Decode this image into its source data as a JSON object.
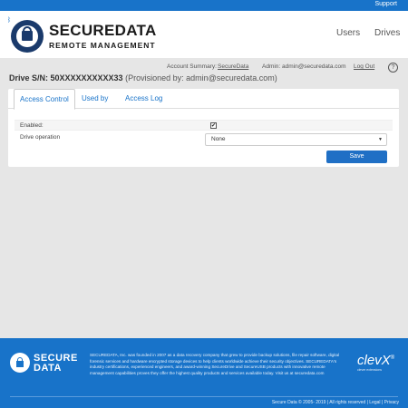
{
  "topbar": {
    "support": "Support"
  },
  "brand": {
    "line1": "SECUREDATA",
    "line2": "REMOTE MANAGEMENT",
    "mark": "®"
  },
  "nav": {
    "users": "Users",
    "drives": "Drives"
  },
  "account": {
    "summary_label": "Account Summary:",
    "summary_link": "SecureData",
    "admin_label": "Admin:",
    "admin_email": "admin@securedata.com",
    "logout": "Log Out",
    "help": "?"
  },
  "drive": {
    "title": "Drive S/N: 50XXXXXXXXXX33",
    "provisioned": "(Provisioned by: admin@securedata.com)"
  },
  "tabs": [
    {
      "label": "Access Control",
      "active": true
    },
    {
      "label": "Used by",
      "active": false
    },
    {
      "label": "Access Log",
      "active": false
    }
  ],
  "form": {
    "enabled_label": "Enabled:",
    "enabled_checked": true,
    "check_glyph": "✔",
    "operation_label": "Drive operation",
    "operation_value": "None",
    "save_label": "Save"
  },
  "footer": {
    "logo_line1": "SECURE",
    "logo_line2": "DATA",
    "about": "SECUREDATA, Inc. was founded in 2007 as a data recovery company that grew to provide backup solutions, file repair software, digital forensic services and hardware encrypted storage devices to help clients worldwide achieve their security objectives. SECUREDATA's industry certifications, experienced engineers, and award-winning SecureDrive and SecureUSB products with innovative remote management capabilities proves they offer the highest quality products and services available today. Visit us at securedata.com",
    "partner": "clevX",
    "partner_mark": "®",
    "partner_sub": "clever  extensions",
    "copyright": "Secure Data © 2005- 2019  |  All rights reserved  |  Legal  |  Privacy"
  },
  "colors": {
    "accent": "#1873c9",
    "button": "#1f6fc5",
    "background": "#e6e6e6"
  }
}
